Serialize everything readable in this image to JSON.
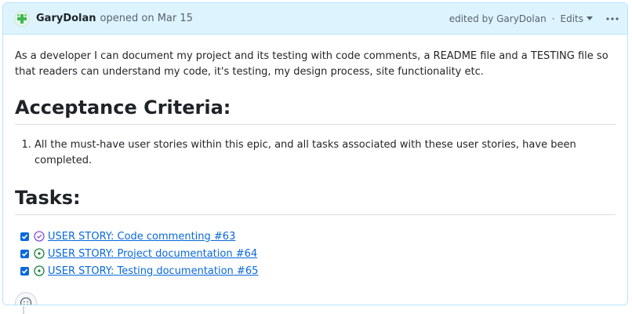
{
  "header": {
    "author": "GaryDolan",
    "opened_text": "opened on Mar 15",
    "edited_text": "edited by GaryDolan",
    "separator": "·",
    "edits_label": "Edits"
  },
  "body": {
    "intro": "As a developer I can document my project and its testing with code comments, a README file and a TESTING file so that readers can understand my code, it's testing, my design process, site functionality etc.",
    "acceptance_heading": "Acceptance Criteria:",
    "criteria": [
      "All the must-have user stories within this epic, and all tasks associated with these user stories, have been completed."
    ],
    "tasks_heading": "Tasks:",
    "tasks": [
      {
        "label": "USER STORY: Code commenting #63",
        "checked": true,
        "state": "closed-completed",
        "state_color": "#8250df"
      },
      {
        "label": "USER STORY: Project documentation #64",
        "checked": true,
        "state": "open",
        "state_color": "#1a7f37"
      },
      {
        "label": "USER STORY: Testing documentation #65",
        "checked": true,
        "state": "open",
        "state_color": "#1a7f37"
      }
    ]
  },
  "icons": {
    "avatar": "avatar-identicon",
    "chevron": "chevron-down-icon",
    "kebab": "kebab-horizontal-icon",
    "reaction": "smiley-icon"
  },
  "colors": {
    "header_bg": "#ddf4ff",
    "border": "#b6e3ff",
    "link": "#0969da"
  }
}
